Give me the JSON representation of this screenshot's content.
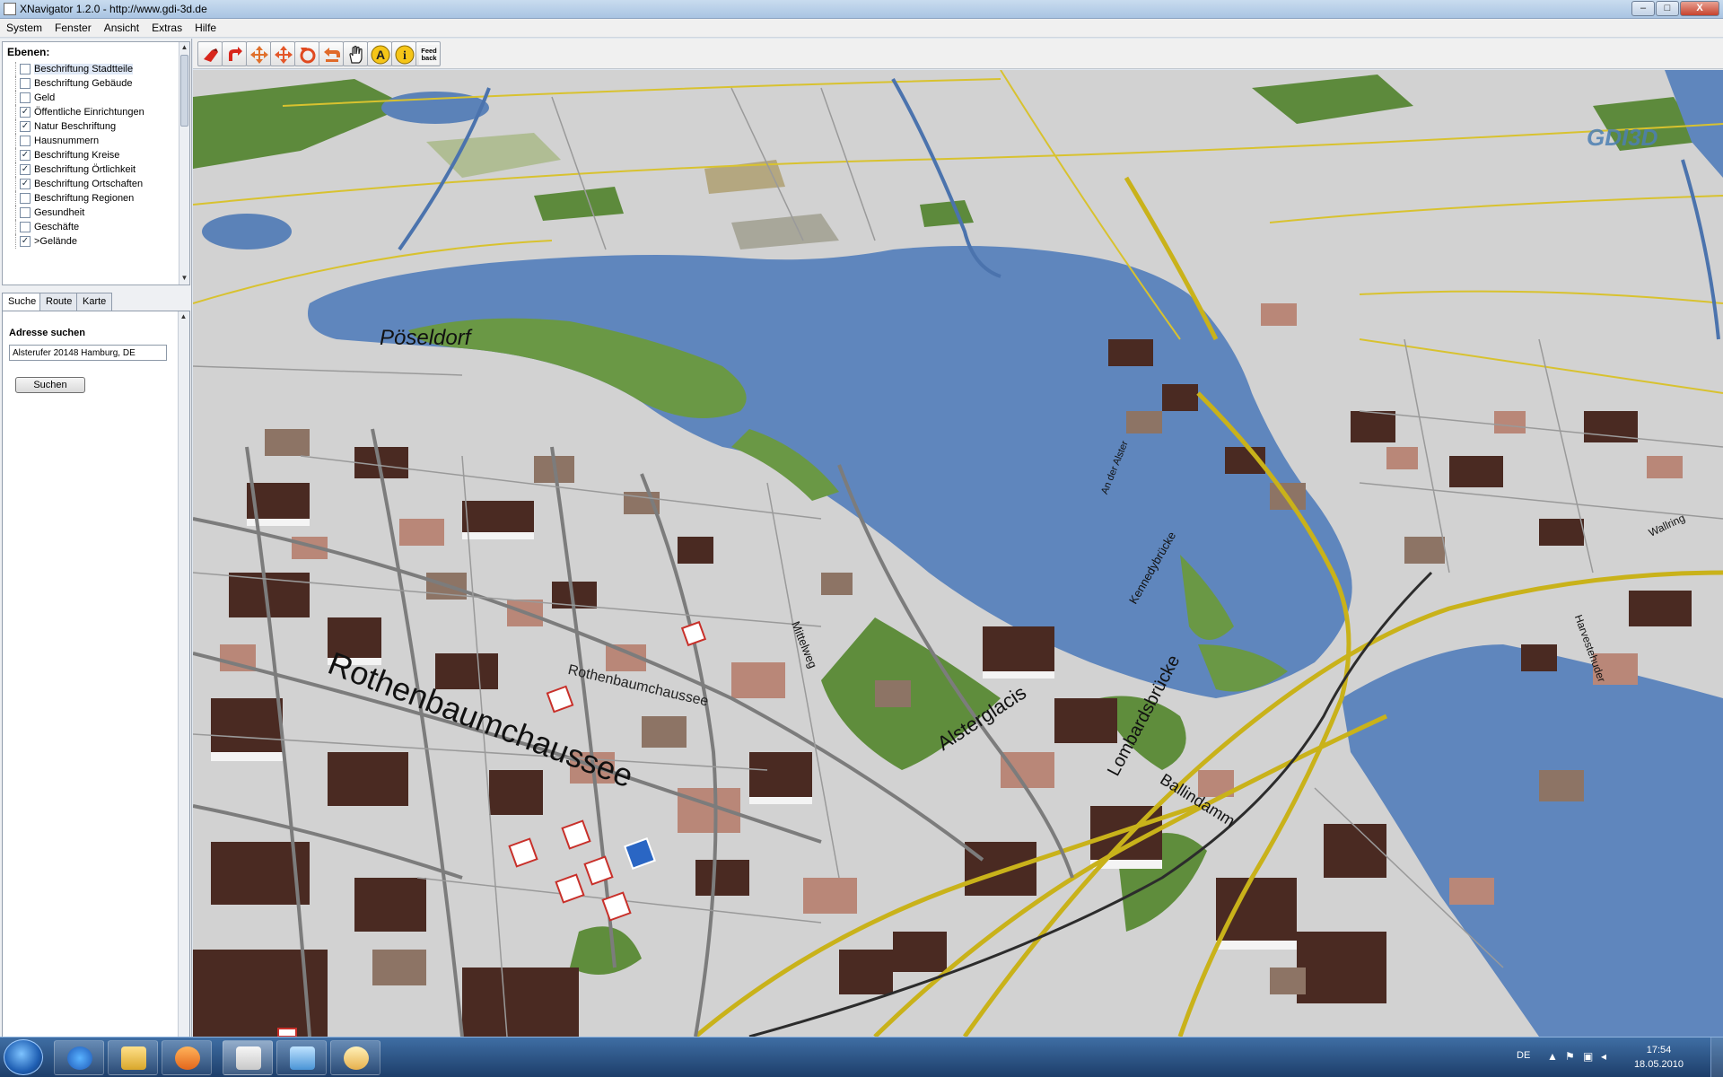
{
  "window": {
    "title": "XNavigator 1.2.0 - http://www.gdi-3d.de",
    "minimize": "–",
    "maximize": "□",
    "close": "X"
  },
  "menu": [
    "System",
    "Fenster",
    "Ansicht",
    "Extras",
    "Hilfe"
  ],
  "layers": {
    "heading": "Ebenen:",
    "items": [
      {
        "label": "Beschriftung Stadtteile",
        "checked": false,
        "selected": true
      },
      {
        "label": "Beschriftung Gebäude",
        "checked": false
      },
      {
        "label": "Geld",
        "checked": false
      },
      {
        "label": "Öffentliche Einrichtungen",
        "checked": true
      },
      {
        "label": "Natur Beschriftung",
        "checked": true
      },
      {
        "label": "Hausnummern",
        "checked": false
      },
      {
        "label": "Beschriftung Kreise",
        "checked": true
      },
      {
        "label": "Beschriftung Örtlichkeit",
        "checked": true
      },
      {
        "label": "Beschriftung Ortschaften",
        "checked": true
      },
      {
        "label": "Beschriftung Regionen",
        "checked": false
      },
      {
        "label": "Gesundheit",
        "checked": false
      },
      {
        "label": "Geschäfte",
        "checked": false
      },
      {
        "label": ">Gelände",
        "checked": true
      }
    ]
  },
  "tabs": [
    "Suche",
    "Route",
    "Karte"
  ],
  "search": {
    "heading": "Adresse suchen",
    "value": "Alsterufer 20148 Hamburg, DE",
    "button": "Suchen"
  },
  "toolbar": {
    "tools": [
      "move-icon",
      "turn-icon",
      "pan-icon",
      "zoom-icon",
      "rotate-icon",
      "back-icon",
      "hand-icon",
      "label-icon",
      "info-icon",
      "feedback-icon"
    ],
    "feedback_label_1": "Feed",
    "feedback_label_2": "back",
    "label_glyph": "A",
    "info_glyph": "i"
  },
  "map": {
    "logo": "GDI3D",
    "labels": {
      "poseldorf": "Pöseldorf",
      "rothenbaum": "Rothenbaumchaussee",
      "rothenbaum_small": "Rothenbaumchaussee",
      "alsterglacis": "Alsterglacis",
      "lombardsbruecke": "Lombardsbrücke",
      "kennedybruecke": "Kennedybrücke",
      "mittelweg": "Mittelweg",
      "harvestehude": "Harvestehuder",
      "ballindamm": "Ballindamm",
      "walkring": "Wallring",
      "an_der_alster": "An der Alster"
    }
  },
  "taskbar": {
    "language": "DE",
    "time": "17:54",
    "date": "18.05.2010"
  }
}
